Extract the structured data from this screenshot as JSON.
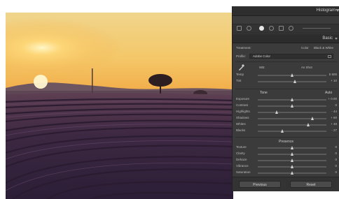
{
  "panel": {
    "histogram_title": "Histogram",
    "basic_title": "Basic",
    "treatment_label": "Treatment:",
    "treatment_color": "Color",
    "treatment_bw": "Black & White",
    "profile_label": "Profile:",
    "profile_value": "Adobe Color",
    "wb_label": "WB:",
    "wb_value": "As Shot",
    "tone_title": "Tone",
    "tone_auto": "Auto",
    "presence_title": "Presence",
    "previous_button": "Previous",
    "reset_button": "Reset"
  },
  "wb_sliders": [
    {
      "label": "Temp",
      "value": "5 500",
      "pos": 0.5
    },
    {
      "label": "Tint",
      "value": "+ 10",
      "pos": 0.55
    }
  ],
  "tone_sliders": [
    {
      "label": "Exposure",
      "value": "+ 0.00",
      "pos": 0.5
    },
    {
      "label": "Contrast",
      "value": "0",
      "pos": 0.5
    },
    {
      "label": "Highlights",
      "value": "- 44",
      "pos": 0.28
    },
    {
      "label": "Shadows",
      "value": "+ 60",
      "pos": 0.8
    },
    {
      "label": "Whites",
      "value": "+ 48",
      "pos": 0.74
    },
    {
      "label": "Blacks",
      "value": "- 27",
      "pos": 0.36
    }
  ],
  "presence_sliders": [
    {
      "label": "Texture",
      "value": "0",
      "pos": 0.5
    },
    {
      "label": "Clarity",
      "value": "0",
      "pos": 0.5
    },
    {
      "label": "Dehaze",
      "value": "0",
      "pos": 0.5
    },
    {
      "label": "Vibrance",
      "value": "0",
      "pos": 0.5
    },
    {
      "label": "Saturation",
      "value": "0",
      "pos": 0.5
    }
  ],
  "colors": {
    "panel_bg": "#3b3b3b",
    "sky_top": "#f1d48a",
    "sun": "#ffe08a",
    "lavender": "#3a2740"
  }
}
